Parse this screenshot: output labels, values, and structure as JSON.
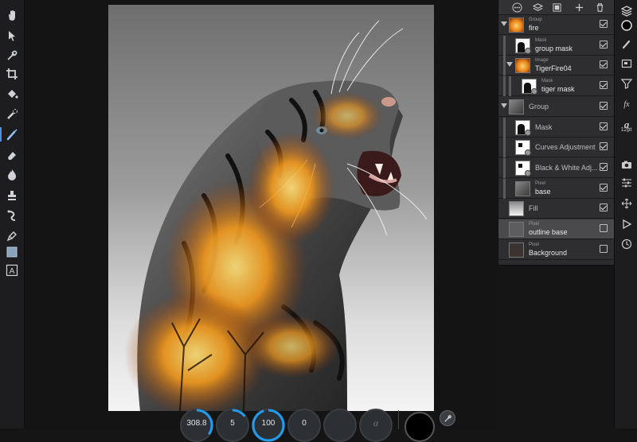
{
  "left_toolbar": {
    "tools": [
      {
        "name": "view-tool",
        "icon": "hand-icon"
      },
      {
        "name": "move-tool",
        "icon": "arrow-pointer-icon"
      },
      {
        "name": "color-picker-tool",
        "icon": "eyedropper-icon"
      },
      {
        "name": "crop-tool",
        "icon": "crop-icon"
      },
      {
        "name": "fill-tool",
        "icon": "paint-bucket-icon"
      },
      {
        "name": "selection-brush-tool",
        "icon": "selection-brush-icon"
      },
      {
        "name": "paint-brush-tool",
        "icon": "brush-icon",
        "active": true
      },
      {
        "name": "erase-brush-tool",
        "icon": "eraser-icon"
      },
      {
        "name": "burn-tool",
        "icon": "flame-icon"
      },
      {
        "name": "clone-tool",
        "icon": "stamp-icon"
      },
      {
        "name": "smudge-tool",
        "icon": "smudge-icon"
      },
      {
        "name": "pen-tool",
        "icon": "pen-nib-icon"
      },
      {
        "name": "shape-tool",
        "icon": "rectangle-icon"
      },
      {
        "name": "text-tool",
        "icon": "text-frame-icon"
      }
    ]
  },
  "bottom_hud": {
    "dials": [
      {
        "label": "308.8",
        "fraction": 0.35
      },
      {
        "label": "5",
        "fraction": 0.15
      },
      {
        "label": "100",
        "fraction": 0.95
      },
      {
        "label": "0",
        "fraction": 0
      },
      {
        "label": "",
        "fraction": 0
      },
      {
        "label": "",
        "fraction": 0,
        "icon": "alpha-icon"
      }
    ],
    "color_well": "#000000"
  },
  "layers_panel": {
    "toolbar_icons": [
      "more-options-icon",
      "layers-stack-icon",
      "adjustment-icon",
      "add-layer-icon",
      "delete-icon"
    ],
    "layers": [
      {
        "type": "Group",
        "name": "fire",
        "thumb": "fire",
        "expanded": true,
        "indent": 0,
        "visible": true
      },
      {
        "type": "Mask",
        "name": "group mask",
        "thumb": "mask",
        "indent": 1,
        "visible": true
      },
      {
        "type": "Image",
        "name": "TigerFire04",
        "thumb": "fire",
        "expanded": true,
        "indent": 1,
        "visible": true
      },
      {
        "type": "Mask",
        "name": "tiger mask",
        "thumb": "mask",
        "indent": 2,
        "visible": true
      },
      {
        "type": "",
        "name": "Group",
        "thumb": "tiger",
        "expanded": true,
        "indent": 0,
        "visible": true
      },
      {
        "type": "",
        "name": "Mask",
        "thumb": "mask",
        "indent": 1,
        "visible": true
      },
      {
        "type": "",
        "name": "Curves Adjustment",
        "thumb": "adjust",
        "indent": 1,
        "visible": true
      },
      {
        "type": "",
        "name": "Black & White Adj...",
        "thumb": "adjust",
        "indent": 1,
        "visible": true
      },
      {
        "type": "Pixel",
        "name": "base",
        "thumb": "tiger",
        "indent": 1,
        "visible": true
      },
      {
        "type": "",
        "name": "Fill",
        "thumb": "gradient",
        "indent": 0,
        "visible": true
      },
      {
        "type": "Pixel",
        "name": "outline base",
        "thumb": "outline",
        "indent": 0,
        "visible": false,
        "selected": true
      },
      {
        "type": "Pixel",
        "name": "Background",
        "thumb": "dark",
        "indent": 0,
        "visible": false
      }
    ]
  },
  "right_toolbar": {
    "text_size": "12pt",
    "icons": [
      "layers-icon",
      "color-icon",
      "brushes-icon",
      "navigator-icon",
      "filter-icon",
      "fx-icon",
      "text-style-icon",
      "camera-icon",
      "sliders-icon",
      "transform-icon",
      "play-icon",
      "history-icon"
    ]
  }
}
